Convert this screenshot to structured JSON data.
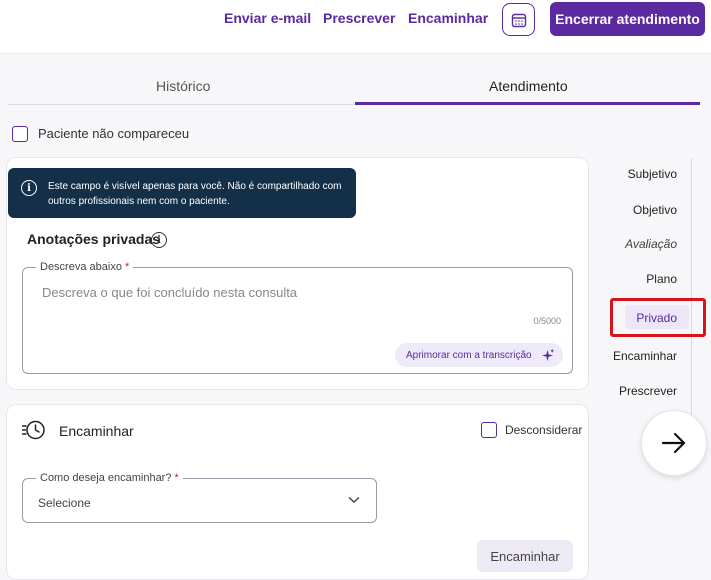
{
  "topbar": {
    "links": [
      "Enviar e-mail",
      "Prescrever",
      "Encaminhar"
    ],
    "calendar_icon": "calendar-icon",
    "end_button": "Encerrar atendimento"
  },
  "tabs": {
    "historico": "Histórico",
    "atendimento": "Atendimento",
    "active": "Atendimento"
  },
  "absent": {
    "label": "Paciente não compareceu",
    "checked": false
  },
  "private_notes": {
    "tooltip": "Este campo é visível apenas para você. Não é compartilhado com outros profissionais nem com o paciente.",
    "title": "Anotações privadas",
    "field_label": "Descreva abaixo",
    "required_mark": "*",
    "placeholder": "Descreva o que foi concluído nesta consulta",
    "counter": "0/5000",
    "ai_button": "Aprimorar com a transcrição",
    "ai_icon": "sparkles-icon"
  },
  "referral": {
    "icon": "history-icon",
    "title": "Encaminhar",
    "disregard_label": "Desconsiderar",
    "field_label": "Como deseja encaminhar?",
    "required_mark": "*",
    "select_value": "Selecione",
    "button": "Encaminhar"
  },
  "side_nav": {
    "items": [
      "Subjetivo",
      "Objetivo",
      "Avaliação",
      "Plano",
      "Privado",
      "Encaminhar",
      "Prescrever"
    ],
    "active": "Privado"
  },
  "colors": {
    "accent": "#5b2aa0",
    "tooltip_bg": "#143049",
    "highlight": "#d6141c"
  }
}
